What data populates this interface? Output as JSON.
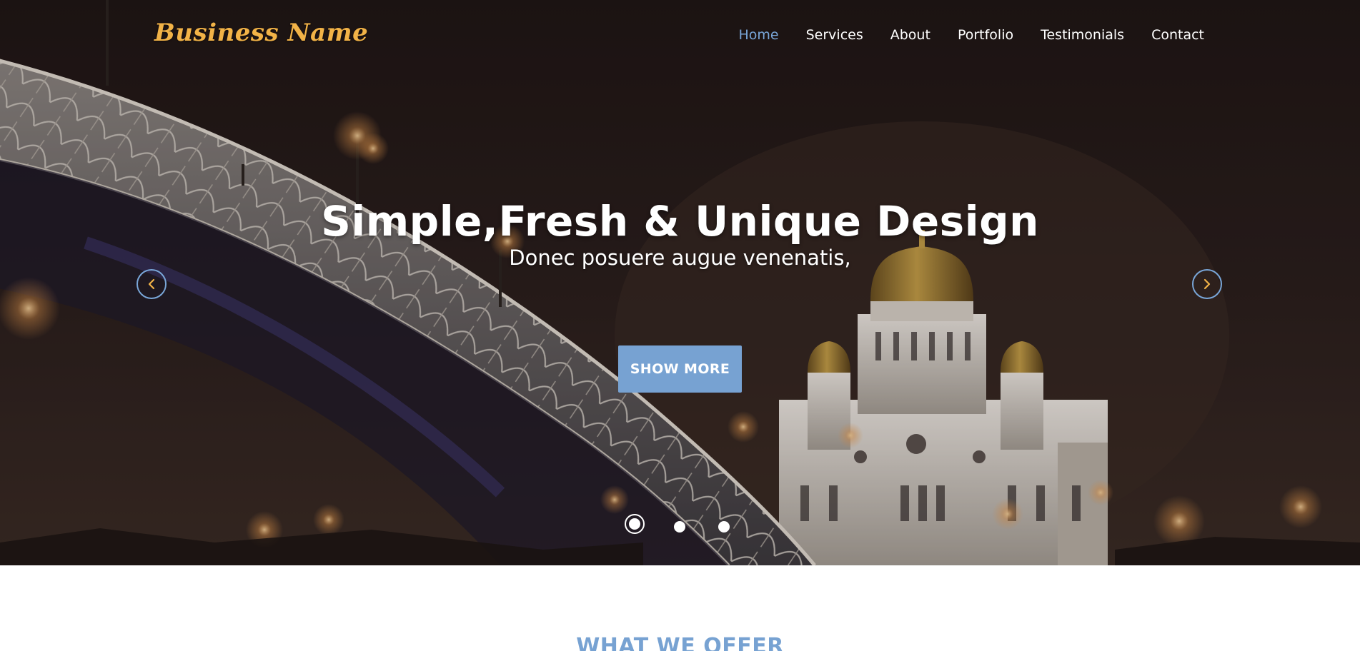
{
  "header": {
    "logo": "Business Name",
    "nav": [
      {
        "label": "Home",
        "active": true
      },
      {
        "label": "Services",
        "active": false
      },
      {
        "label": "About",
        "active": false
      },
      {
        "label": "Portfolio",
        "active": false
      },
      {
        "label": "Testimonials",
        "active": false
      },
      {
        "label": "Contact",
        "active": false
      }
    ]
  },
  "hero": {
    "title": "Simple,Fresh & Unique Design",
    "subtitle": "Donec posuere augue venenatis,",
    "cta_label": "SHOW MORE",
    "prev_icon": "chevron-left-icon",
    "next_icon": "chevron-right-icon",
    "slides_total": 3,
    "active_slide": 1
  },
  "offer": {
    "title": "WHAT WE OFFER"
  },
  "colors": {
    "accent": "#77a2d2",
    "logo": "#f2b347",
    "arrow_glyph": "#f2b347",
    "text_light": "#ffffff"
  }
}
